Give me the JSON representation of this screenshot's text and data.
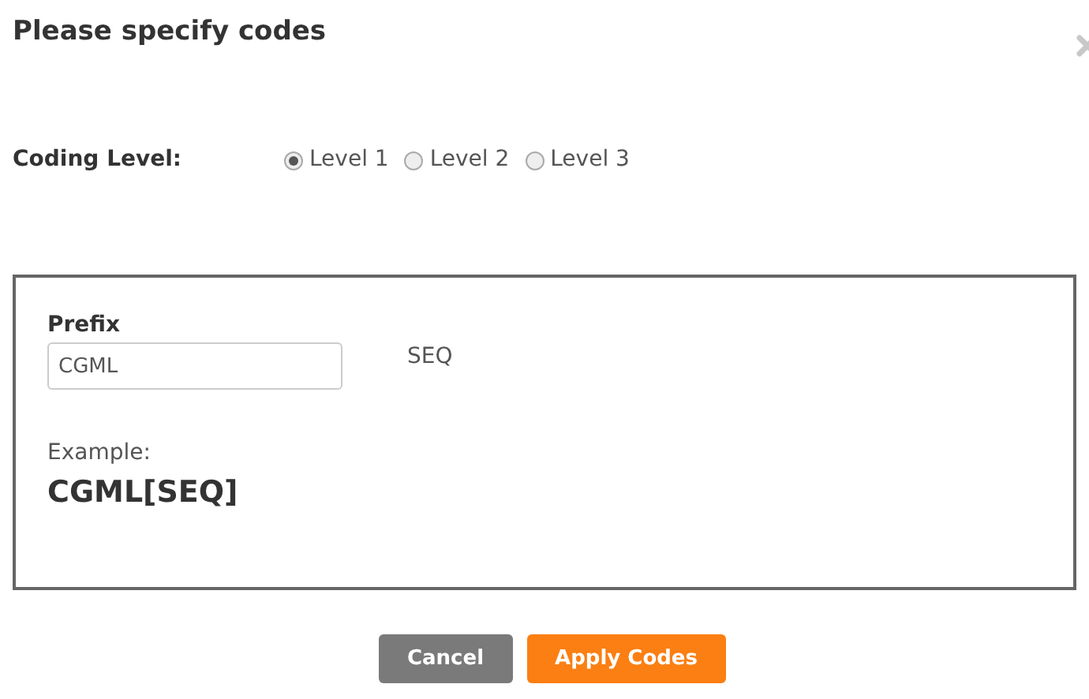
{
  "dialog": {
    "title": "Please specify codes"
  },
  "coding_level": {
    "label": "Coding Level:",
    "options": [
      {
        "label": "Level 1",
        "selected": true
      },
      {
        "label": "Level 2",
        "selected": false
      },
      {
        "label": "Level 3",
        "selected": false
      }
    ]
  },
  "prefix": {
    "label": "Prefix",
    "value": "CGML"
  },
  "sequence_label": "SEQ",
  "example": {
    "label": "Example:",
    "value": "CGML[SEQ]"
  },
  "buttons": [
    {
      "label": "Cancel",
      "kind": "secondary"
    },
    {
      "label": "Apply Codes",
      "kind": "primary"
    }
  ]
}
